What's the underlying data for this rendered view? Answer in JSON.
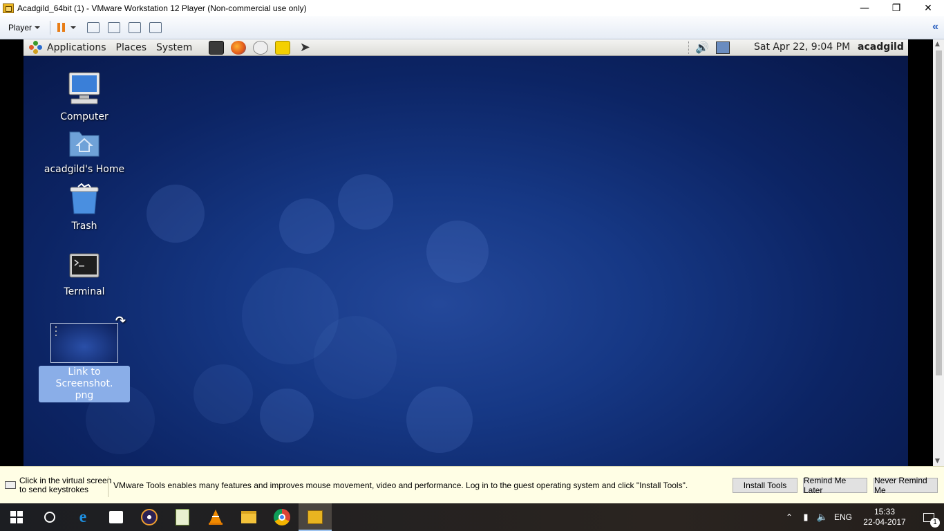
{
  "window": {
    "title": "Acadgild_64bit (1) - VMware Workstation 12 Player (Non-commercial use only)"
  },
  "toolbar": {
    "player_label": "Player"
  },
  "guest": {
    "panel": {
      "menus": [
        "Applications",
        "Places",
        "System"
      ],
      "clock": "Sat Apr 22,  9:04 PM",
      "user": "acadgild"
    },
    "desktop_icons": [
      {
        "label": "Computer",
        "icon": "computer-icon"
      },
      {
        "label": "acadgild's Home",
        "icon": "home-folder-icon"
      },
      {
        "label": "Trash",
        "icon": "trash-icon"
      },
      {
        "label": "Terminal",
        "icon": "terminal-icon"
      },
      {
        "label": "Link to Screenshot.\npng",
        "icon": "screenshot-thumbnail-icon",
        "selected": true
      }
    ]
  },
  "notification": {
    "hint_line1": "Click in the virtual screen",
    "hint_line2": "to send keystrokes",
    "message": "VMware Tools enables many features and improves mouse movement, video and performance. Log in to the guest operating system and click \"Install Tools\".",
    "buttons": {
      "install": "Install Tools",
      "remind": "Remind Me Later",
      "never": "Never Remind Me"
    }
  },
  "taskbar": {
    "language": "ENG",
    "time": "15:33",
    "date": "22-04-2017",
    "notification_count": "1"
  },
  "colors": {
    "desktop_blue": "#163885",
    "selection": "#8aaee8",
    "notify_bg": "#fffee5"
  }
}
